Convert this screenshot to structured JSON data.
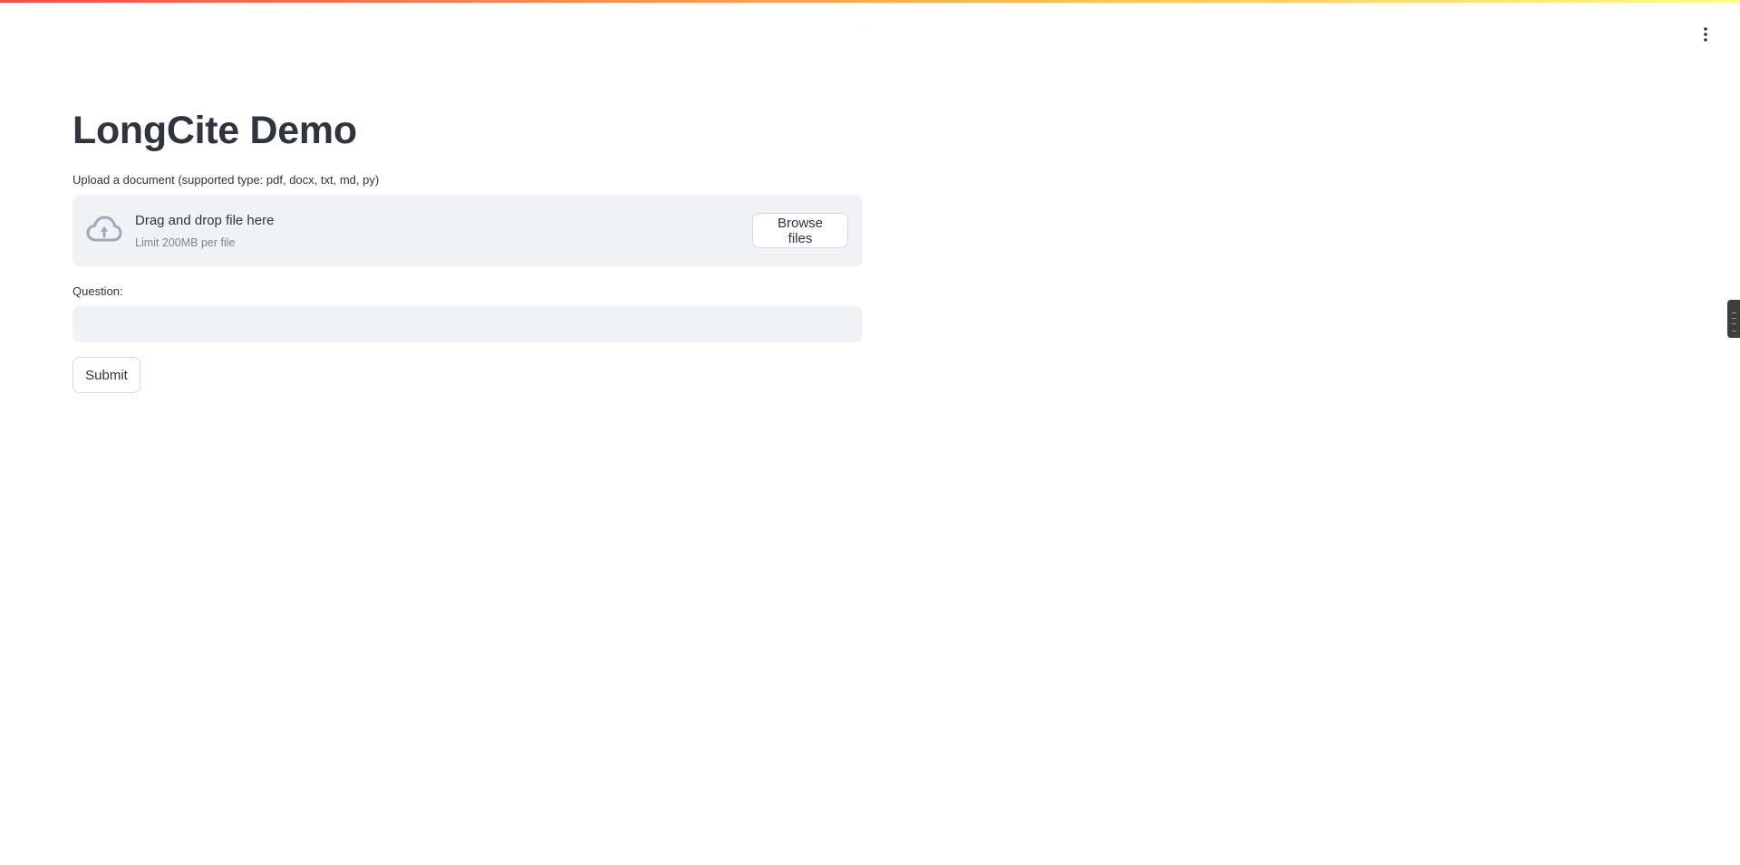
{
  "page": {
    "title": "LongCite Demo"
  },
  "menu": {
    "icon": "vertical-ellipsis-icon"
  },
  "uploader": {
    "label": "Upload a document (supported type: pdf, docx, txt, md, py)",
    "icon": "cloud-upload-icon",
    "drop_text": "Drag and drop file here",
    "limit_text": "Limit 200MB per file",
    "browse_label": "Browse files"
  },
  "question": {
    "label": "Question:",
    "value": "",
    "placeholder": ""
  },
  "submit": {
    "label": "Submit"
  },
  "colors": {
    "accent_gradient_start": "#ff4b4b",
    "accent_gradient_end": "#fffd80",
    "widget_background": "#f0f2f6",
    "text": "#31333f",
    "muted_text": "#808495",
    "icon": "#a3a8b8"
  }
}
